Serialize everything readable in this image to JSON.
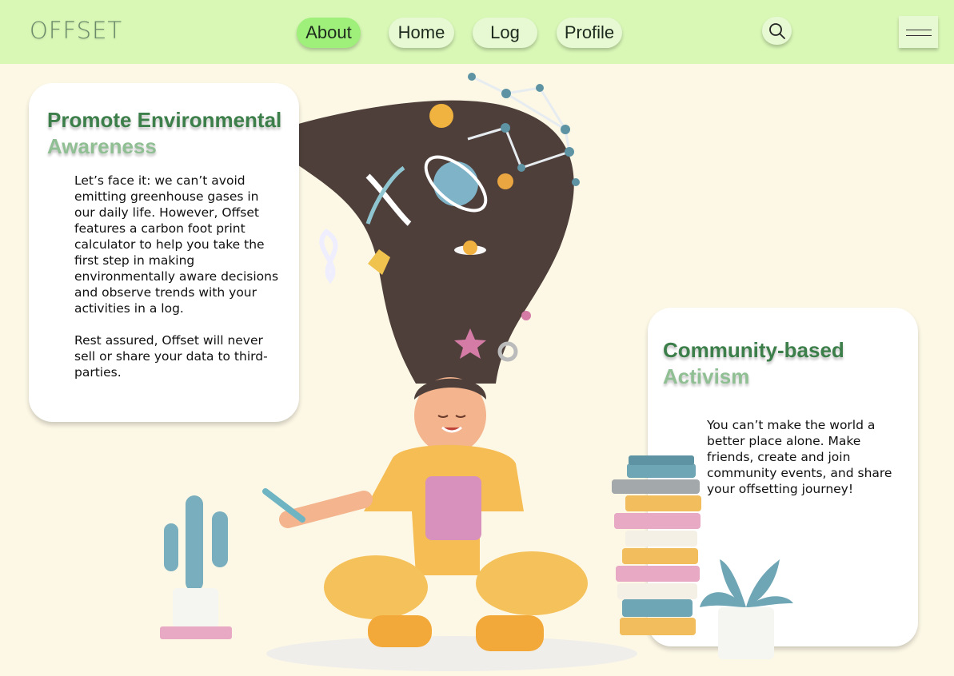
{
  "header": {
    "logo": "OFFSET",
    "nav": [
      {
        "label": "About",
        "active": true
      },
      {
        "label": "Home",
        "active": false
      },
      {
        "label": "Log",
        "active": false
      },
      {
        "label": "Profile",
        "active": false
      }
    ],
    "search_icon": "search-icon",
    "menu_icon": "hamburger-menu-icon"
  },
  "cards": {
    "awareness": {
      "title_line1": "Promote Environmental",
      "title_line2": "Awareness",
      "paragraph1": "Let’s face it: we can’t avoid emitting greenhouse gases in our daily life. However, Offset features a carbon foot print calculator to help you take the first step in making environmentally aware decisions and observe trends with your activities in a log.",
      "paragraph2": "Rest assured, Offset will never sell or share your data to third-parties."
    },
    "community": {
      "title_line1": "Community-based",
      "title_line2": "Activism",
      "paragraph1": "You can’t make the world a better place alone. Make friends, create and join community events, and share your offsetting journey!"
    }
  },
  "colors": {
    "header_bg": "#d9f8b6",
    "page_bg": "#fdf8e6",
    "active_nav": "#9ff07a",
    "title_green": "#3d7f4a",
    "title_light": "#8fbf93"
  }
}
